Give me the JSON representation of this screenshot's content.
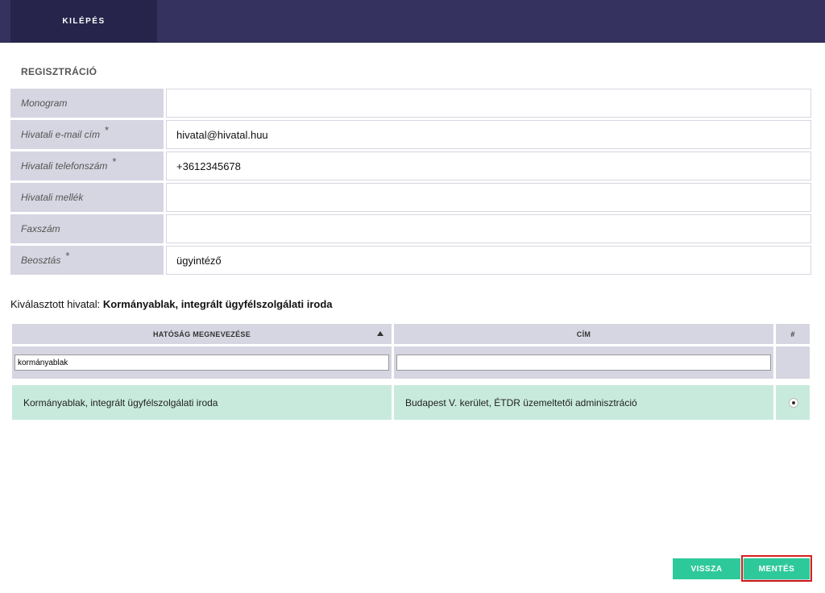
{
  "header": {
    "logout_label": "KILÉPÉS"
  },
  "registration": {
    "title": "REGISZTRÁCIÓ",
    "fields": [
      {
        "label": "Monogram",
        "value": "",
        "required": false
      },
      {
        "label": "Hivatali e-mail cím",
        "value": "hivatal@hivatal.huu",
        "required": true
      },
      {
        "label": "Hivatali telefonszám",
        "value": "+3612345678",
        "required": true
      },
      {
        "label": "Hivatali mellék",
        "value": "",
        "required": false
      },
      {
        "label": "Faxszám",
        "value": "",
        "required": false
      },
      {
        "label": "Beosztás",
        "value": "ügyintéző",
        "required": true
      }
    ],
    "required_mark": "*"
  },
  "selected_office": {
    "prefix": "Kiválasztott hivatal:",
    "name": "Kormányablak, integrált ügyfélszolgálati iroda"
  },
  "table": {
    "headers": [
      "HATÓSÁG MEGNEVEZÉSE",
      "CÍM",
      "#"
    ],
    "filters": {
      "name": "kormányablak",
      "address": ""
    },
    "rows": [
      {
        "name": "Kormányablak, integrált ügyfélszolgálati iroda",
        "address": "Budapest V. kerület, ÉTDR üzemeltetői adminisztráció",
        "selected": true
      }
    ]
  },
  "buttons": {
    "back": "VISSZA",
    "save": "MENTÉS"
  },
  "colors": {
    "header": "#35325f",
    "accent": "#2ec99a",
    "highlight_border": "#d9201f",
    "row_selected": "#c8eadd"
  }
}
